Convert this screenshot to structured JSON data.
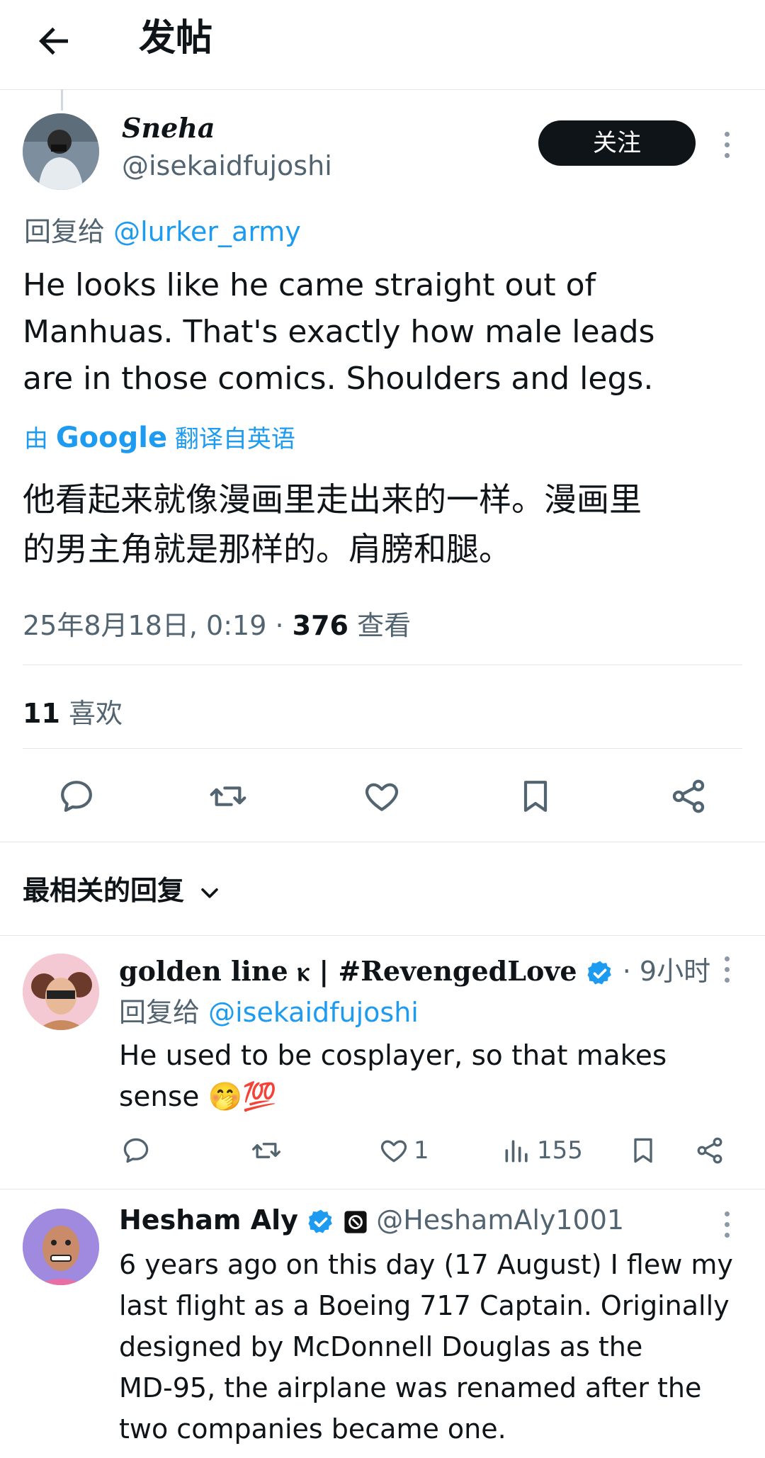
{
  "header": {
    "title": "发帖"
  },
  "post": {
    "display_name": "Sneha",
    "handle": "@isekaidfujoshi",
    "follow_label": "关注",
    "reply_to_prefix": "回复给",
    "reply_to_handle": "@lurker_army",
    "body_lines": [
      "He looks like he came straight out of",
      "Manhuas. That's exactly how male leads",
      "are in those comics. Shoulders and legs."
    ],
    "translate_prefix": "由",
    "translate_brand": "Google",
    "translate_suffix": "翻译自英语",
    "translated_lines": [
      "他看起来就像漫画里走出来的一样。漫画里",
      "的男主角就是那样的。肩膀和腿。"
    ],
    "timestamp": "25年8月18日, 0:19",
    "separator": "·",
    "views_count": "376",
    "views_label": "查看",
    "likes_count": "11",
    "likes_label": "喜欢"
  },
  "replies_header": {
    "label": "最相关的回复"
  },
  "replies": [
    {
      "display_name": "golden line ⲕ | #RevengedLove",
      "time": "· 9小时",
      "reply_to_prefix": "回复给",
      "reply_to_handle": "@isekaidfujoshi",
      "body_lines": [
        "He used to be cosplayer, so that makes",
        "sense 🤭💯"
      ],
      "like_count": "1",
      "view_count": "155"
    },
    {
      "display_name": "Hesham Aly",
      "handle": "@HeshamAly1001",
      "body_lines": [
        "6 years ago on this day (17 August) I flew my",
        "last flight as a Boeing 717 Captain. Originally",
        "designed by McDonnell Douglas as the",
        "MD-95, the airplane was renamed after the",
        "two companies became one."
      ]
    }
  ],
  "colors": {
    "accent": "#1d9bf0",
    "muted": "#536471",
    "text": "#0f1419",
    "divider": "#e6e6e6"
  }
}
